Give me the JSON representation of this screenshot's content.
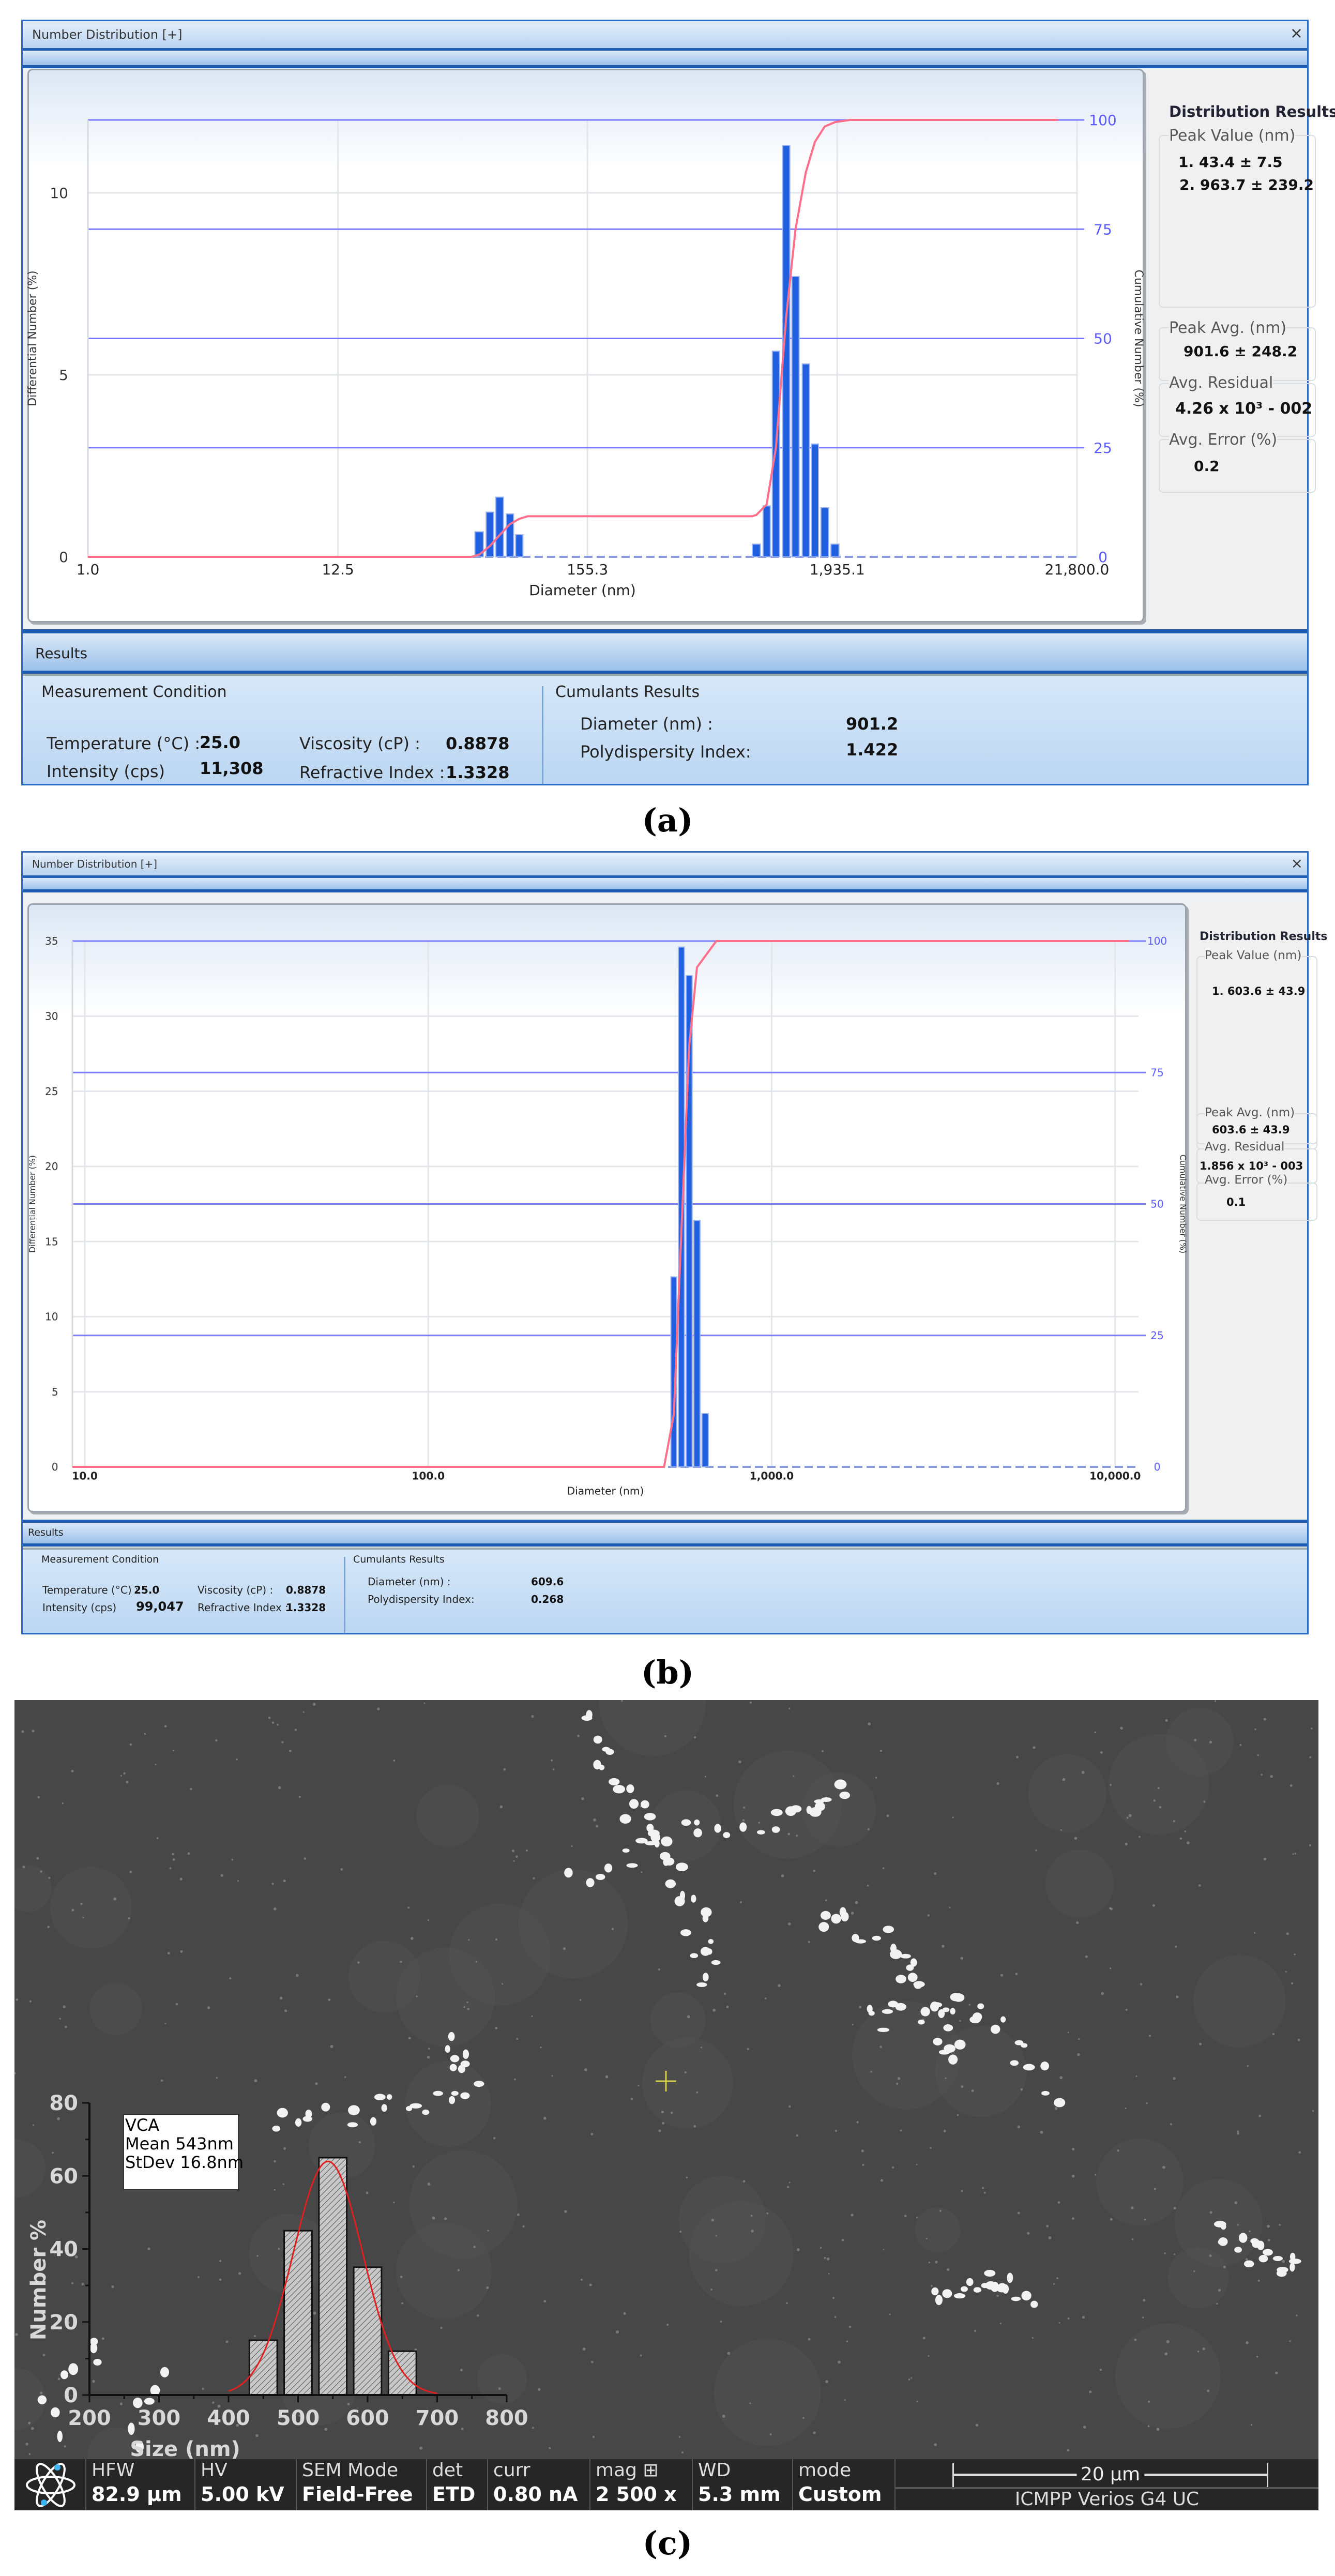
{
  "panel_a": {
    "window_title": "Number Distribution [+]",
    "close_label": "×",
    "results_title": "Results",
    "distribution_results": {
      "heading": "Distribution Results",
      "peak_value_label": "Peak Value (nm)",
      "peak_values": [
        "1. 43.4 ± 7.5",
        "2. 963.7 ± 239.2"
      ],
      "peak_avg_label": "Peak Avg. (nm)",
      "peak_avg": "901.6 ± 248.2",
      "avg_residual_label": "Avg. Residual",
      "avg_residual": "4.26 x 10³ - 002",
      "avg_error_label": "Avg. Error (%)",
      "avg_error": "0.2"
    },
    "measurement_condition": {
      "heading": "Measurement Condition",
      "temperature_label": "Temperature (°C) :",
      "temperature": "25.0",
      "intensity_label": "Intensity (cps)",
      "intensity": "11,308",
      "viscosity_label": "Viscosity (cP) :",
      "viscosity": "0.8878",
      "refractive_index_label": "Refractive Index :",
      "refractive_index": "1.3328"
    },
    "cumulants_results": {
      "heading": "Cumulants Results",
      "diameter_label": "Diameter (nm) :",
      "diameter": "901.2",
      "pdi_label": "Polydispersity Index:",
      "pdi": "1.422"
    },
    "caption": "(a)"
  },
  "panel_b": {
    "window_title": "Number Distribution [+]",
    "close_label": "×",
    "results_title": "Results",
    "distribution_results": {
      "heading": "Distribution Results",
      "peak_value_label": "Peak Value (nm)",
      "peak_values": [
        "1. 603.6 ± 43.9"
      ],
      "peak_avg_label": "Peak Avg. (nm)",
      "peak_avg": "603.6 ± 43.9",
      "avg_residual_label": "Avg. Residual",
      "avg_residual": "1.856 x 10³ - 003",
      "avg_error_label": "Avg. Error (%)",
      "avg_error": "0.1"
    },
    "measurement_condition": {
      "heading": "Measurement Condition",
      "temperature_label": "Temperature (°C) :",
      "temperature": "25.0",
      "intensity_label": "Intensity (cps)",
      "intensity": "99,047",
      "viscosity_label": "Viscosity (cP) :",
      "viscosity": "0.8878",
      "refractive_index_label": "Refractive Index :",
      "refractive_index": "1.3328"
    },
    "cumulants_results": {
      "heading": "Cumulants Results",
      "diameter_label": "Diameter (nm) :",
      "diameter": "609.6",
      "pdi_label": "Polydispersity Index:",
      "pdi": "0.268"
    },
    "caption": "(b)"
  },
  "panel_c": {
    "caption": "(c)",
    "info_bar": [
      {
        "key": "HFW",
        "value": "82.9 µm"
      },
      {
        "key": "HV",
        "value": "5.00 kV"
      },
      {
        "key": "SEM Mode",
        "value": "Field-Free"
      },
      {
        "key": "det",
        "value": "ETD"
      },
      {
        "key": "curr",
        "value": "0.80 nA"
      },
      {
        "key": "mag ⊞",
        "value": "2 500 x"
      },
      {
        "key": "WD",
        "value": "5.3 mm"
      },
      {
        "key": "mode",
        "value": "Custom"
      }
    ],
    "scale_bar_label": "20 µm",
    "instrument": "ICMPP Verios G4 UC",
    "logo_icon": "atom-icon"
  },
  "chart_data": [
    {
      "type": "bar",
      "title": "Number Distribution",
      "xlabel": "Diameter (nm)",
      "ylabel": "Differential Number (%)",
      "y2label": "Cumulative Number (%)",
      "xscale": "log",
      "xlim": [
        1.0,
        21800.0
      ],
      "xticks": [
        1.0,
        12.5,
        155.3,
        1935.1,
        21800.0
      ],
      "xtick_labels": [
        "1.0",
        "12.5",
        "155.3",
        "1,935.1",
        "21,800.0"
      ],
      "ylim": [
        0,
        12
      ],
      "yticks": [
        0,
        5,
        10
      ],
      "y2lim": [
        0,
        100
      ],
      "y2ticks": [
        0,
        25,
        50,
        75,
        100
      ],
      "bars": {
        "x": [
          52,
          58,
          64,
          71,
          78,
          855,
          949,
          1042,
          1156,
          1270,
          1409,
          1545,
          1706,
          1892
        ],
        "y": [
          0.69,
          1.23,
          1.64,
          1.18,
          0.61,
          0.35,
          1.4,
          5.65,
          11.3,
          7.7,
          5.3,
          3.1,
          1.35,
          0.35
        ]
      },
      "cumulative": {
        "x": [
          1,
          48,
          52,
          58,
          64,
          71,
          78,
          85,
          820,
          855,
          949,
          1042,
          1156,
          1270,
          1409,
          1545,
          1706,
          1892,
          2200,
          18000
        ],
        "y": [
          0,
          0,
          0.5,
          2.5,
          5,
          7.5,
          8.7,
          9.3,
          9.3,
          9.6,
          12,
          25,
          55,
          75,
          88,
          95,
          98.5,
          99.5,
          100,
          100
        ]
      },
      "colors": {
        "bars": "#1f5fe0",
        "cumulative": "#ff6f8a",
        "grid25": "#7b7bff",
        "tick_right": "#5b5bff"
      }
    },
    {
      "type": "bar",
      "title": "Number Distribution",
      "xlabel": "Diameter (nm)",
      "ylabel": "Differential Number (%)",
      "y2label": "Cumulative Number (%)",
      "xscale": "log",
      "xlim": [
        9.2,
        11700
      ],
      "xticks": [
        10,
        100,
        1000,
        10000
      ],
      "xtick_labels": [
        "10.0",
        "100.0",
        "1,000.0",
        "10,000.0"
      ],
      "ylim": [
        0,
        35
      ],
      "yticks": [
        0,
        5,
        10,
        15,
        20,
        25,
        30,
        35
      ],
      "y2lim": [
        0,
        100
      ],
      "y2ticks": [
        0,
        25,
        50,
        75,
        100
      ],
      "bars": {
        "x": [
          519,
          546,
          575,
          606,
          640
        ],
        "y": [
          12.65,
          34.6,
          32.7,
          16.4,
          3.55
        ]
      },
      "cumulative": {
        "x": [
          9.2,
          486,
          519,
          546,
          575,
          606,
          690,
          11000
        ],
        "y": [
          0,
          0,
          10,
          45,
          80,
          95,
          100,
          100
        ]
      },
      "colors": {
        "bars": "#1f5fe0",
        "cumulative": "#ff6f8a",
        "grid25": "#7b7bff",
        "tick_right": "#5b5bff"
      }
    },
    {
      "type": "bar",
      "title": "",
      "xlabel": "Size (nm)",
      "ylabel": "Number %",
      "xlim": [
        200,
        800
      ],
      "xticks": [
        200,
        300,
        400,
        500,
        600,
        700,
        800
      ],
      "ylim": [
        0,
        80
      ],
      "yticks": [
        0,
        20,
        40,
        60,
        80
      ],
      "categories": [
        450,
        500,
        550,
        600,
        650
      ],
      "values": [
        15,
        45,
        65,
        35,
        12
      ],
      "legend": [
        "VCA",
        "Mean 543nm",
        "StDev 16.8nm"
      ],
      "fit": {
        "type": "gaussian",
        "mean": 543,
        "sigma": 50,
        "amplitude": 64
      },
      "colors": {
        "bars": "#bdbdbd",
        "fit": "#e02020",
        "axes": "#111111",
        "ticks": "#d8d8d8"
      }
    }
  ]
}
